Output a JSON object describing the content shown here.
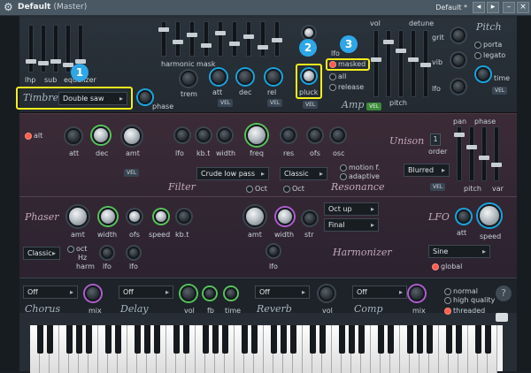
{
  "window": {
    "title": "Default",
    "subtitle": "(Master)",
    "preset": "Default *"
  },
  "top": {
    "lhp": "lhp",
    "sub": "sub",
    "equalizer": "equalizer",
    "harmonic_mask": "harmonic mask",
    "trem": "trem",
    "att": "att",
    "dec": "dec",
    "rel": "rel",
    "pluck": "pluck",
    "vel": "VEL",
    "lfo": "lfo",
    "masked": "masked",
    "all": "all",
    "release": "release",
    "amp": "Amp",
    "vol": "vol",
    "detune": "detune",
    "grit": "grit",
    "vib": "vib",
    "lfo2": "lfo",
    "pitch_label": "pitch",
    "pitch_title": "Pitch",
    "porta": "porta",
    "legato": "legato",
    "time": "time",
    "timbre": "Timbre",
    "timbre_value": "Double saw",
    "phase": "phase"
  },
  "filter": {
    "alt": "alt",
    "att": "att",
    "dec": "dec",
    "amt": "amt",
    "lfo": "lfo",
    "kbt": "kb.t",
    "width": "width",
    "freq": "freq",
    "res": "res",
    "ofs": "ofs",
    "osc": "osc",
    "vel": "VEL",
    "type": "Crude low pass",
    "title": "Filter",
    "oct": "Oct",
    "resonance_type": "Classic",
    "resonance_title": "Resonance",
    "oct2": "Oct",
    "motion": "motion f.",
    "adaptive": "adaptive",
    "unison": "Unison",
    "unison_count": "1",
    "order": "order",
    "pan": "pan",
    "phase": "phase",
    "pitch": "pitch",
    "var": "var",
    "unison_mode": "Blurred",
    "vel2": "VEL"
  },
  "phaser": {
    "title": "Phaser",
    "amt": "amt",
    "width": "width",
    "ofs": "ofs",
    "speed": "speed",
    "kbt": "kb.t",
    "mode": "Classic",
    "oct": "oct",
    "hz": "Hz",
    "harm": "harm",
    "lfo": "lfo",
    "lfo2": "lfo"
  },
  "harmonizer": {
    "amt": "amt",
    "width": "width",
    "str": "str",
    "lfo": "lfo",
    "title": "Harmonizer",
    "octave": "Oct up",
    "mode": "Final"
  },
  "lfo": {
    "title": "LFO",
    "att": "att",
    "speed": "speed",
    "shape": "Sine",
    "global": "global"
  },
  "effects": {
    "chorus": "Chorus",
    "chorus_value": "Off",
    "mix": "mix",
    "delay": "Delay",
    "delay_value": "Off",
    "vol": "vol",
    "fb": "fb",
    "time": "time",
    "reverb": "Reverb",
    "reverb_value": "Off",
    "vol2": "vol",
    "comp": "Comp",
    "comp_value": "Off",
    "mix2": "mix",
    "normal": "normal",
    "high_quality": "high quality",
    "threaded": "threaded",
    "help": "?"
  },
  "callouts": [
    "1",
    "2",
    "3"
  ],
  "icons": {
    "gear": "gear-icon",
    "minimize": "minimize-icon",
    "restore": "restore-icon",
    "close": "close-icon",
    "keyboard": "keyboard-icon",
    "help": "help-icon"
  },
  "colors": {
    "accent_blue": "#1aa4de",
    "accent_green": "#58c35a",
    "accent_purple": "#b25dcf",
    "highlight": "#f4ee1c",
    "active_radio": "#ff5d4d"
  }
}
